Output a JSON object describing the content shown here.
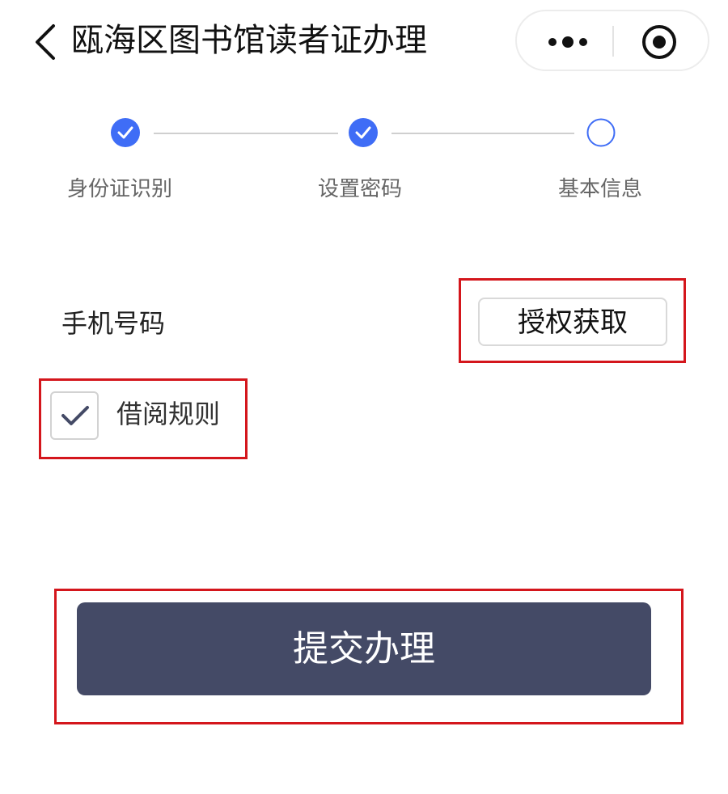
{
  "header": {
    "title": "瓯海区图书馆读者证办理",
    "back_icon": "chevron-left-icon",
    "more_icon": "more-dots-icon",
    "close_icon": "target-circle-icon"
  },
  "steps": [
    {
      "label": "身份证识别",
      "status": "completed"
    },
    {
      "label": "设置密码",
      "status": "completed"
    },
    {
      "label": "基本信息",
      "status": "current"
    }
  ],
  "form": {
    "phone_label": "手机号码",
    "auth_button": "授权获取",
    "rules_label": "借阅规则",
    "rules_checked": true
  },
  "submit_label": "提交办理",
  "colors": {
    "step_active": "#3f6df6",
    "button_dark": "#444a66",
    "highlight_box": "#d4161c"
  }
}
